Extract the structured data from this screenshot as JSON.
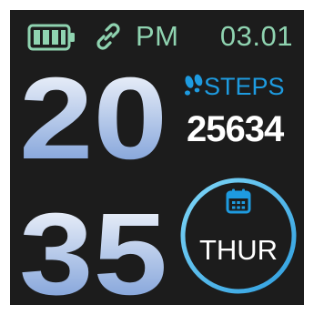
{
  "status_bar": {
    "battery_icon": "battery-full-icon",
    "link_icon": "link-icon",
    "ampm": "PM",
    "date": "03.01",
    "accent_color": "#8fd3b0"
  },
  "time": {
    "hours": "20",
    "minutes": "35",
    "gradient_top": "#ffffff",
    "gradient_bottom": "#6e94d4"
  },
  "steps": {
    "icon": "footprints-icon",
    "label": "STEPS",
    "value": "25634",
    "label_color": "#1e9be0"
  },
  "day": {
    "icon": "calendar-icon",
    "label": "THUR",
    "ring_color": "#5fc4f0"
  }
}
